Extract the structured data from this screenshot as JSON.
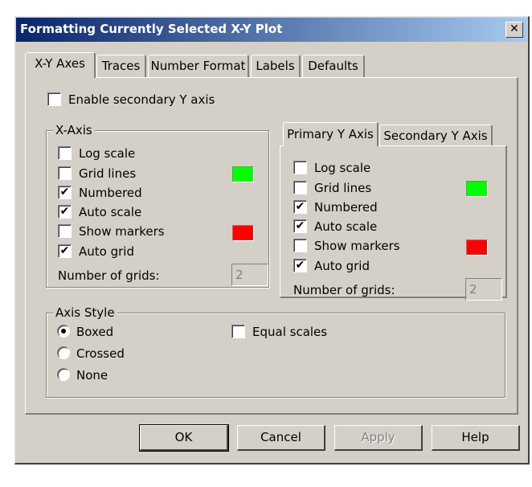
{
  "window": {
    "title": "Formatting Currently Selected X-Y Plot",
    "close_glyph": "✕"
  },
  "tabs": [
    {
      "label": "X-Y Axes",
      "active": true
    },
    {
      "label": "Traces",
      "active": false
    },
    {
      "label": "Number Format",
      "active": false
    },
    {
      "label": "Labels",
      "active": false
    },
    {
      "label": "Defaults",
      "active": false
    }
  ],
  "enable_secondary": {
    "label": "Enable secondary Y axis",
    "checked": false
  },
  "x_axis": {
    "title": "X-Axis",
    "options": [
      {
        "label": "Log scale",
        "checked": false
      },
      {
        "label": "Grid lines",
        "checked": false
      },
      {
        "label": "Numbered",
        "checked": true
      },
      {
        "label": "Auto scale",
        "checked": true
      },
      {
        "label": "Show markers",
        "checked": false
      },
      {
        "label": "Auto grid",
        "checked": true
      }
    ],
    "grid_color": "#00ff00",
    "marker_color": "#ff0000",
    "num_grids_label": "Number of grids:",
    "num_grids_value": "2"
  },
  "y_tabs": [
    {
      "label": "Primary Y Axis",
      "active": true
    },
    {
      "label": "Secondary Y Axis",
      "active": false
    }
  ],
  "y_axis": {
    "options": [
      {
        "label": "Log scale",
        "checked": false
      },
      {
        "label": "Grid lines",
        "checked": false
      },
      {
        "label": "Numbered",
        "checked": true
      },
      {
        "label": "Auto scale",
        "checked": true
      },
      {
        "label": "Show markers",
        "checked": false
      },
      {
        "label": "Auto grid",
        "checked": true
      }
    ],
    "grid_color": "#00ff00",
    "marker_color": "#ff0000",
    "num_grids_label": "Number of grids:",
    "num_grids_value": "2"
  },
  "axis_style": {
    "title": "Axis Style",
    "options": [
      {
        "label": "Boxed",
        "selected": true
      },
      {
        "label": "Crossed",
        "selected": false
      },
      {
        "label": "None",
        "selected": false
      }
    ],
    "equal_scales": {
      "label": "Equal scales",
      "checked": false
    }
  },
  "buttons": {
    "ok": "OK",
    "cancel": "Cancel",
    "apply": "Apply",
    "help": "Help"
  },
  "check_glyph": "✔",
  "colors": {
    "dialog_bg": "#d4d0c8",
    "title_start": "#0a246a",
    "title_end": "#a6caf0"
  }
}
